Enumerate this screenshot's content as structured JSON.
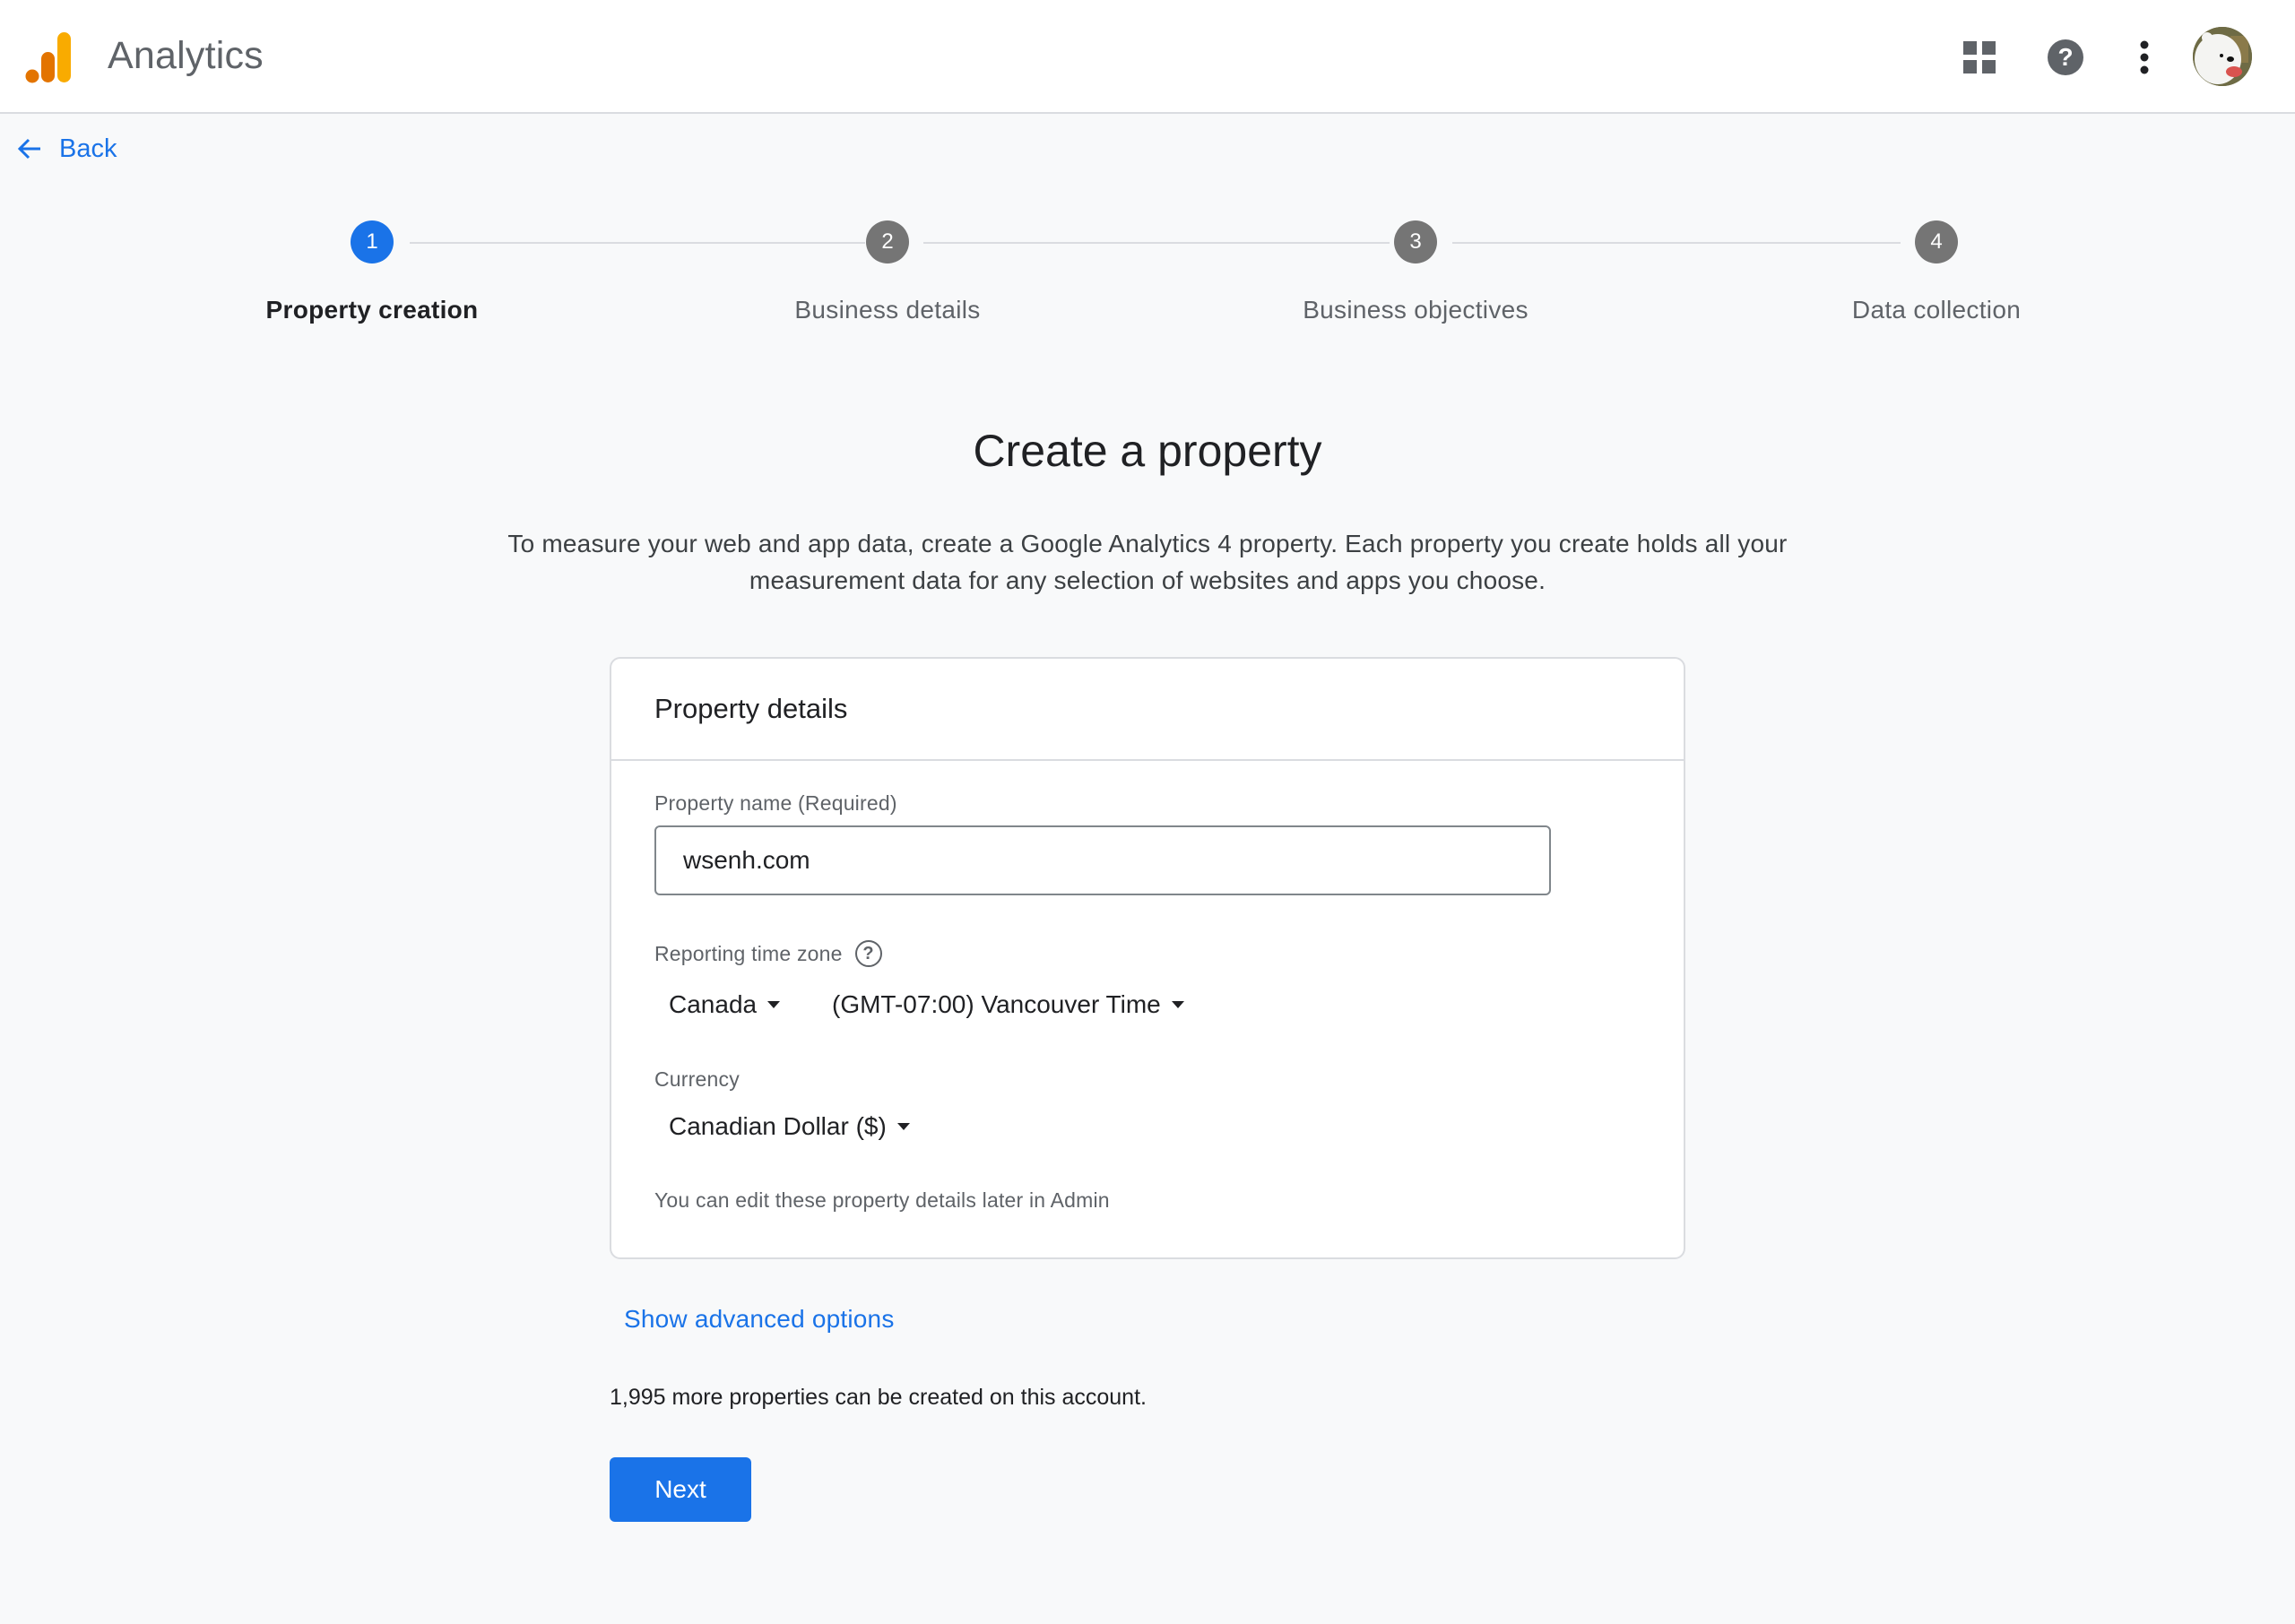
{
  "header": {
    "app_title": "Analytics",
    "icons": [
      "apps-grid-icon",
      "help-icon",
      "more-vert-icon",
      "avatar"
    ]
  },
  "nav": {
    "back_label": "Back"
  },
  "stepper": {
    "steps": [
      {
        "number": "1",
        "label": "Property creation",
        "state": "active"
      },
      {
        "number": "2",
        "label": "Business details",
        "state": "pending"
      },
      {
        "number": "3",
        "label": "Business objectives",
        "state": "pending"
      },
      {
        "number": "4",
        "label": "Data collection",
        "state": "pending"
      }
    ]
  },
  "main": {
    "title": "Create a property",
    "description": "To measure your web and app data, create a Google Analytics 4 property. Each property you create holds all your measurement data for any selection of websites and apps you choose."
  },
  "card": {
    "title": "Property details",
    "property_name_label": "Property name (Required)",
    "property_name_value": "wsenh.com",
    "timezone_label": "Reporting time zone",
    "country_value": "Canada",
    "timezone_value": "(GMT-07:00) Vancouver Time",
    "currency_label": "Currency",
    "currency_value": "Canadian Dollar ($)",
    "hint": "You can edit these property details later in Admin"
  },
  "footer": {
    "advanced_link": "Show advanced options",
    "count_text": "1,995 more properties can be created on this account.",
    "next_label": "Next"
  },
  "colors": {
    "accent": "#1a73e8",
    "step_inactive": "#757575",
    "logo_dark": "#e37400",
    "logo_light": "#f9ab00"
  }
}
